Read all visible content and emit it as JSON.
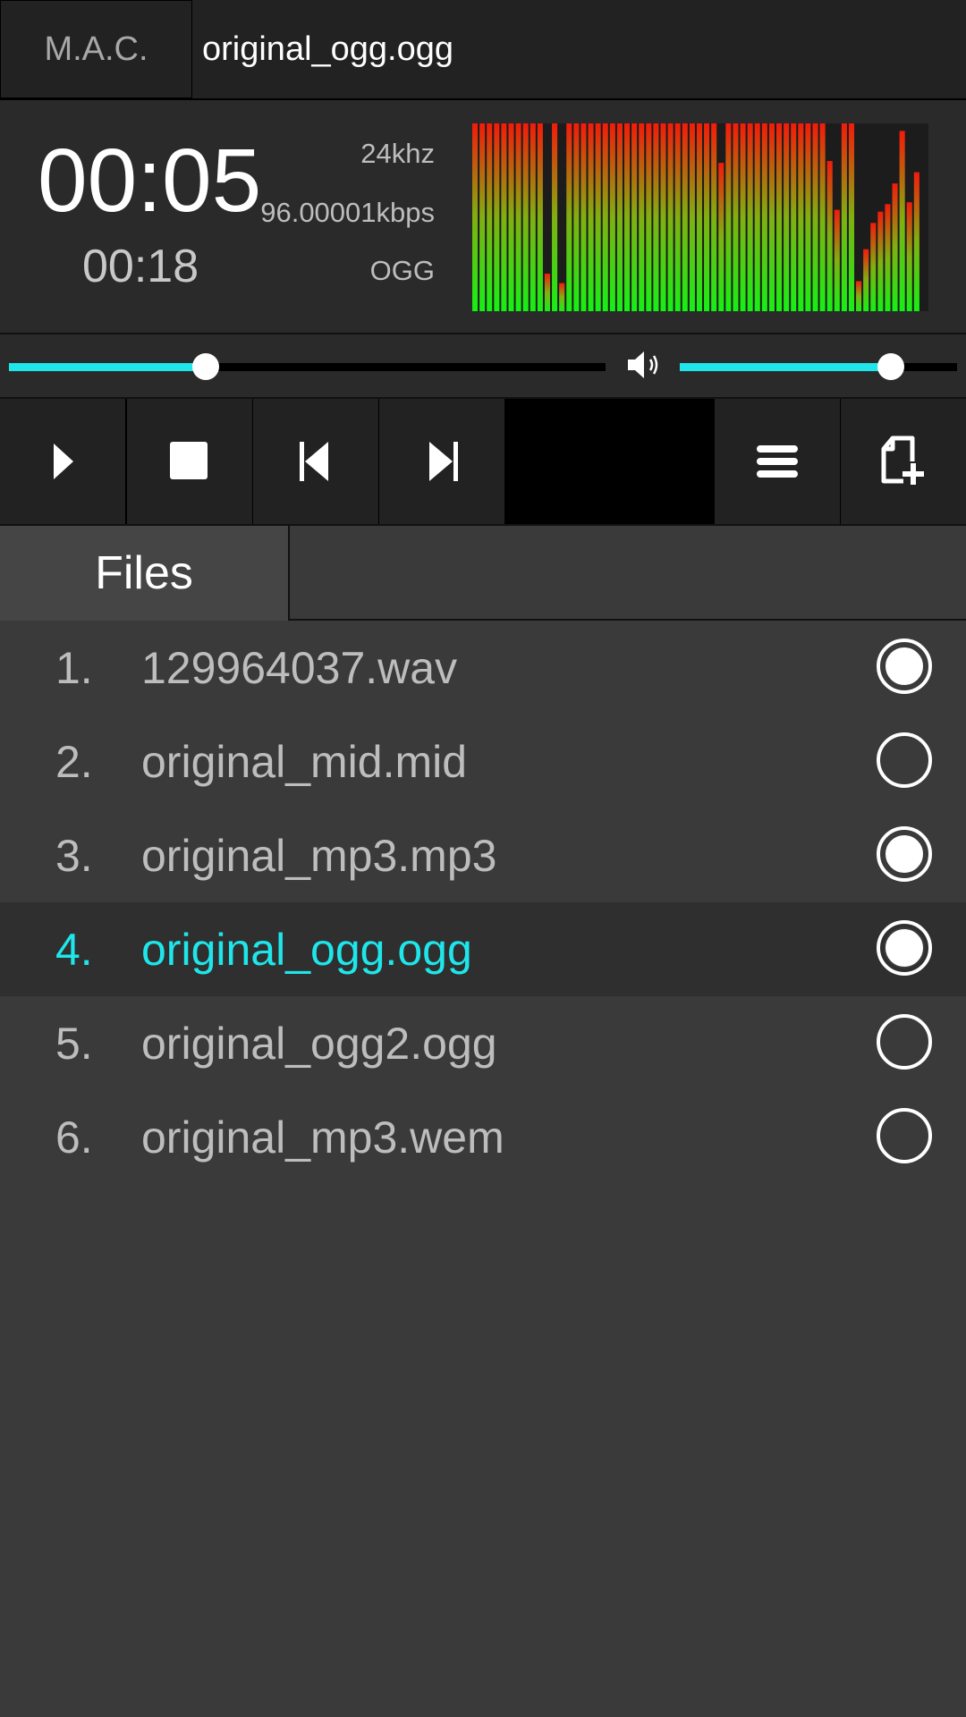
{
  "header": {
    "app_name": "M.A.C.",
    "track_title": "original_ogg.ogg"
  },
  "info": {
    "elapsed": "00:05",
    "total": "00:18",
    "sample_rate": "24khz",
    "bitrate": "96.00001kbps",
    "format": "OGG"
  },
  "spectrum": {
    "levels": [
      1,
      1,
      1,
      1,
      1,
      1,
      1,
      1,
      1,
      1,
      0.2,
      1,
      0.15,
      1,
      1,
      1,
      1,
      1,
      1,
      1,
      1,
      1,
      1,
      1,
      1,
      1,
      1,
      1,
      1,
      1,
      1,
      1,
      1,
      1,
      0.79,
      1,
      1,
      1,
      1,
      1,
      1,
      1,
      1,
      1,
      1,
      1,
      1,
      1,
      1,
      0.8,
      0.54,
      1,
      1,
      0.16,
      0.33,
      0.47,
      0.53,
      0.57,
      0.68,
      0.96,
      0.58,
      0.74,
      0
    ]
  },
  "seek": {
    "progress": 0.33
  },
  "volume": {
    "level": 0.76
  },
  "controls": {
    "play": "play-icon",
    "stop": "stop-icon",
    "previous": "skip-previous-icon",
    "next": "skip-next-icon",
    "playlist": "menu-icon",
    "add": "add-file-icon"
  },
  "tabs": [
    {
      "label": "Files"
    }
  ],
  "playlist": {
    "items": [
      {
        "num": "1.",
        "name": "129964037.wav",
        "radio": "filled"
      },
      {
        "num": "2.",
        "name": "original_mid.mid",
        "radio": "empty"
      },
      {
        "num": "3.",
        "name": "original_mp3.mp3",
        "radio": "filled"
      },
      {
        "num": "4.",
        "name": "original_ogg.ogg",
        "radio": "filled",
        "active": true
      },
      {
        "num": "5.",
        "name": "original_ogg2.ogg",
        "radio": "empty"
      },
      {
        "num": "6.",
        "name": "original_mp3.wem",
        "radio": "empty"
      }
    ]
  },
  "colors": {
    "accent": "#1ee6ea",
    "background": "#3a3a3a",
    "panel": "#2a2a2a"
  }
}
